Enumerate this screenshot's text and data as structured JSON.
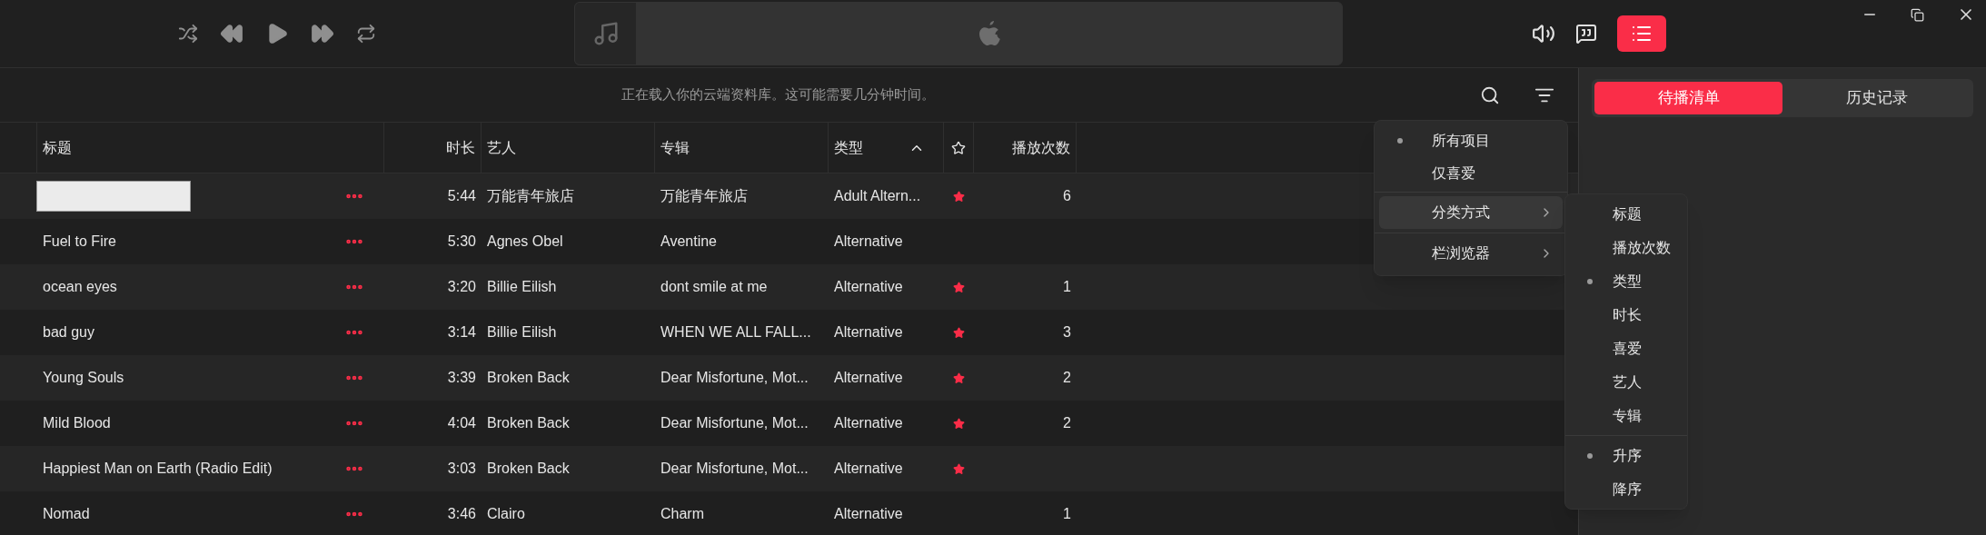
{
  "status_message": "正在载入你的云端资料库。这可能需要几分钟时间。",
  "queue_tabs": [
    {
      "label": "待播清单",
      "selected": true
    },
    {
      "label": "历史记录",
      "selected": false
    }
  ],
  "table": {
    "columns": [
      "标题",
      "时长",
      "艺人",
      "专辑",
      "类型",
      "播放次数"
    ],
    "rows": [
      {
        "kind": "editing",
        "duration": "5:44",
        "artist": "万能青年旅店",
        "album": "万能青年旅店",
        "genre": "Adult Altern...",
        "favorite": true,
        "plays": "6"
      },
      {
        "kind": "song",
        "title": "Fuel to Fire",
        "duration": "5:30",
        "artist": "Agnes Obel",
        "album": "Aventine",
        "genre": "Alternative",
        "favorite": false
      },
      {
        "kind": "song",
        "title": "ocean eyes",
        "duration": "3:20",
        "artist": "Billie Eilish",
        "album": "dont smile at me",
        "genre": "Alternative",
        "favorite": true,
        "plays": "1"
      },
      {
        "kind": "song",
        "title": "bad guy",
        "duration": "3:14",
        "artist": "Billie Eilish",
        "album": "WHEN WE ALL FALL...",
        "genre": "Alternative",
        "favorite": true,
        "plays": "3"
      },
      {
        "kind": "song",
        "title": "Young Souls",
        "duration": "3:39",
        "artist": "Broken Back",
        "album": "Dear Misfortune, Mot...",
        "genre": "Alternative",
        "favorite": true,
        "plays": "2"
      },
      {
        "kind": "song",
        "title": "Mild Blood",
        "duration": "4:04",
        "artist": "Broken Back",
        "album": "Dear Misfortune, Mot...",
        "genre": "Alternative",
        "favorite": true,
        "plays": "2"
      },
      {
        "kind": "song",
        "title": "Happiest Man on Earth (Radio Edit)",
        "duration": "3:03",
        "artist": "Broken Back",
        "album": "Dear Misfortune, Mot...",
        "genre": "Alternative",
        "favorite": true
      },
      {
        "kind": "song",
        "title": "Nomad",
        "duration": "3:46",
        "artist": "Clairo",
        "album": "Charm",
        "genre": "Alternative",
        "favorite": false,
        "plays": "1"
      }
    ]
  },
  "view_menu": {
    "groups": [
      [
        {
          "label": "所有项目",
          "selected": true
        },
        {
          "label": "仅喜爱",
          "selected": false
        }
      ],
      [
        {
          "label": "分类方式",
          "submenu": true,
          "expanded": true
        }
      ],
      [
        {
          "label": "栏浏览器",
          "submenu": true,
          "expanded": false
        }
      ]
    ]
  },
  "sort_menu": {
    "groups": [
      [
        {
          "label": "标题",
          "selected": false
        },
        {
          "label": "播放次数",
          "selected": false
        },
        {
          "label": "类型",
          "selected": true
        },
        {
          "label": "时长",
          "selected": false
        },
        {
          "label": "喜爱",
          "selected": false
        },
        {
          "label": "艺人",
          "selected": false
        },
        {
          "label": "专辑",
          "selected": false
        }
      ],
      [
        {
          "label": "升序",
          "selected": true
        },
        {
          "label": "降序",
          "selected": false
        }
      ]
    ]
  }
}
